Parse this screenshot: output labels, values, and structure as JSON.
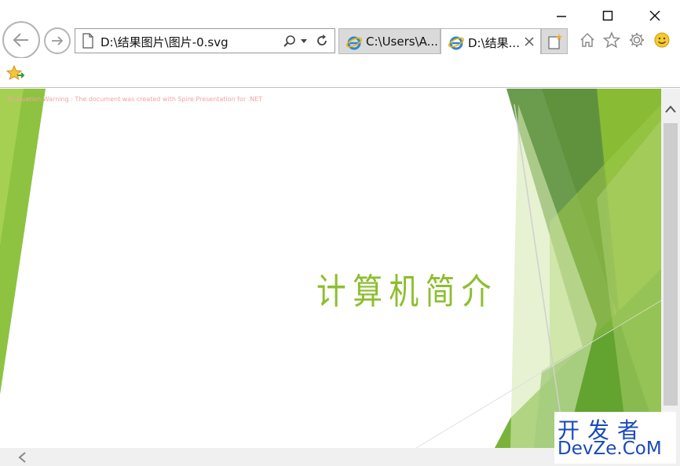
{
  "window": {
    "minimize_label": "—",
    "maximize_label": "☐",
    "close_label": "✕"
  },
  "address_bar": {
    "url": "D:\\结果图片\\图片-0.svg"
  },
  "tabs": [
    {
      "label": "C:\\Users\\A...",
      "active": false
    },
    {
      "label": "D:\\结果...",
      "active": true
    }
  ],
  "slide": {
    "warning": "Evaluation Warning : The document was created with  Spire.Presentation for .NET",
    "title": "计算机简介"
  },
  "watermark": {
    "line1": "开发者",
    "line2": "DevZe.CoM"
  },
  "colors": {
    "accent_green": "#8dbe2e",
    "dark_green": "#5e8f3a",
    "light_green": "#c9e29a",
    "watermark_blue": "#1a49b8"
  }
}
